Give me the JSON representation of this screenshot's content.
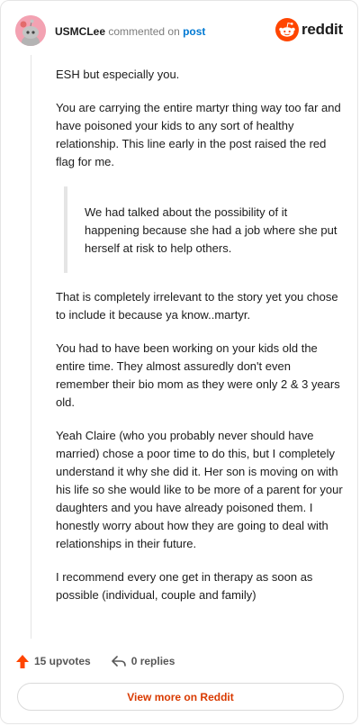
{
  "header": {
    "username": "USMCLee",
    "action": "commented on",
    "post_link": "post",
    "brand": "reddit"
  },
  "avatar": {
    "icon": "snoo-avatar-icon",
    "color": "#f3a2b2"
  },
  "comment": {
    "p1": "ESH but especially you.",
    "p2": "You are carrying the entire martyr thing way too far and have poisoned your kids to any sort of healthy relationship. This line early in the post raised the red flag for me.",
    "quote": "We had talked about the possibility of it happening because she had a job where she put herself at risk to help others.",
    "p3": "That is completely irrelevant to the story yet you chose to include it because ya know..martyr.",
    "p4": "You had to have been working on your kids old the entire time. They almost assuredly don't even remember their bio mom as they were only 2 & 3 years old.",
    "p5": "Yeah Claire (who you probably never should have married) chose a poor time to do this, but I completely understand it why she did it. Her son is moving on with his life so she would like to be more of a parent for your daughters and you have already poisoned them. I honestly worry about how they are going to deal with relationships in their future.",
    "p6": "I recommend every one get in therapy as soon as possible (individual, couple and family)"
  },
  "footer": {
    "upvotes": "15 upvotes",
    "replies": "0 replies",
    "view_more": "View more on Reddit"
  },
  "colors": {
    "upvote": "#ff4500",
    "link": "#0079d3",
    "view_more": "#d93a00",
    "brand": "#ff4500"
  }
}
